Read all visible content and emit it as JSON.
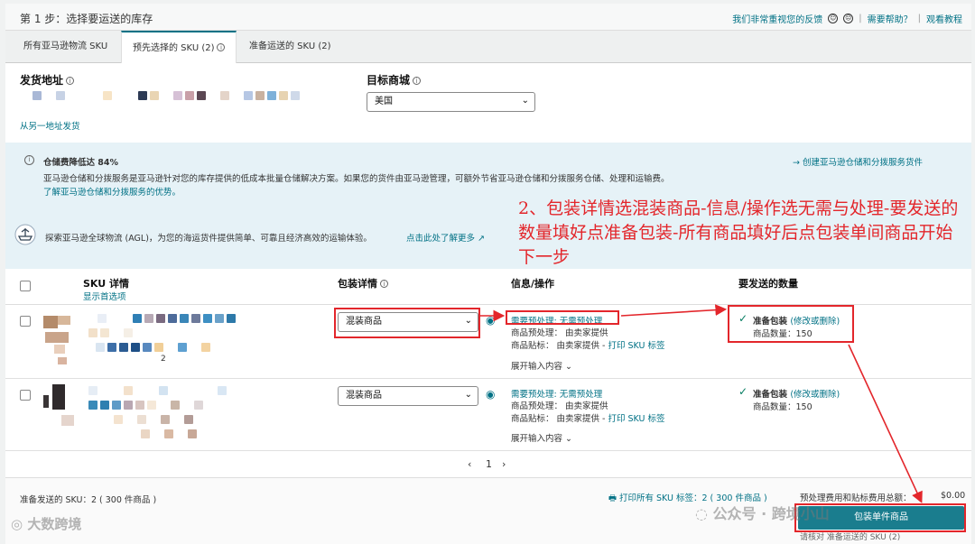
{
  "header": {
    "step_title": "第 1 步：选择要运送的库存",
    "feedback": "我们非常重视您的反馈",
    "help": "需要帮助？",
    "tutorial": "观看教程"
  },
  "tabs": [
    {
      "label": "所有亚马逊物流 SKU"
    },
    {
      "label": "预先选择的 SKU (2)"
    },
    {
      "label": "准备运送的 SKU (2)"
    }
  ],
  "ship_from": {
    "label": "发货地址",
    "alt_link": "从另一地址发货"
  },
  "marketplace": {
    "label": "目标商城",
    "value": "美国"
  },
  "banner": {
    "title": "仓储费降低达 84%",
    "body": "亚马逊仓储和分拨服务是亚马逊针对您的库存提供的低成本批量仓储解决方案。如果您的货件由亚马逊管理，可额外节省亚马逊仓储和分拨服务仓储、处理和运输费。",
    "learn_link": "了解亚马逊仓储和分拨服务的优势。",
    "create_link": "创建亚马逊仓储和分拨服务货件",
    "agl_text": "探索亚马逊全球物流 (AGL)，为您的海运货件提供简单、可靠且经济高效的运输体验。",
    "agl_link": "点击此处了解更多"
  },
  "annotation": "2、包装详情选混装商品-信息/操作选无需与处理-要发送的数量填好点准备包装-所有商品填好后点包装单间商品开始下一步",
  "table": {
    "col_sku": "SKU 详情",
    "show_preselected": "显示首选项",
    "col_packing": "包装详情",
    "col_info": "信息/操作",
    "col_qty": "要发送的数量"
  },
  "rows": [
    {
      "packing": "混装商品",
      "prep_required": "需要预处理: 无需预处理",
      "prep": "商品预处理： 由卖家提供",
      "label": "商品贴标： 由卖家提供 - ",
      "label_link": "打印 SKU 标签",
      "expand": "展开输入内容",
      "ready": "准备包装",
      "edit": "(修改或删除)",
      "qty": "商品数量：150",
      "sku_code": "2"
    },
    {
      "packing": "混装商品",
      "prep_required": "需要预处理: 无需预处理",
      "prep": "商品预处理： 由卖家提供",
      "label": "商品贴标： 由卖家提供 - ",
      "label_link": "打印 SKU 标签",
      "expand": "展开输入内容",
      "ready": "准备包装",
      "edit": "(修改或删除)",
      "qty": "商品数量：150"
    }
  ],
  "pager": {
    "prev": "‹",
    "page": "1",
    "next": "›"
  },
  "footer": {
    "summary": "准备发送的 SKU：2 ( 300 件商品 )",
    "print_all": "打印所有 SKU 标签：2 ( 300 件商品 )",
    "fee_label": "预处理费用和贴标费用总额：",
    "fee_value": "$0.00",
    "pack_button": "包装单件商品",
    "check_note": "请核对 准备运送的 SKU (2)"
  },
  "watermarks": {
    "left": "大数跨境",
    "right": "公众号 · 跨境小山"
  },
  "colors": {
    "accent": "#007185",
    "annotation_red": "#e3262b",
    "primary_button": "#1a7d8e",
    "banner_bg": "#e6f2f7"
  }
}
